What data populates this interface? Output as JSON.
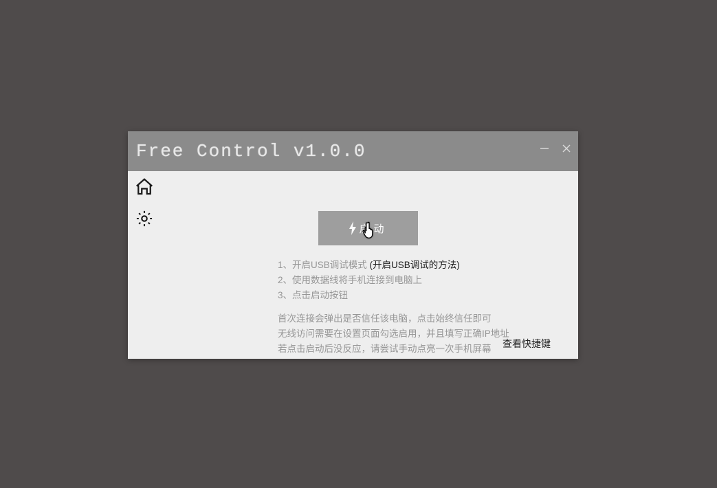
{
  "titlebar": {
    "title": "Free Control v1.0.0"
  },
  "main": {
    "start_label": "启动"
  },
  "instructions": {
    "step1_prefix": "1、开启USB调试模式",
    "step1_link": "(开启USB调试的方法)",
    "step2": "2、使用数据线将手机连接到电脑上",
    "step3": "3、点击启动按钮"
  },
  "notes": {
    "line1": "首次连接会弹出是否信任该电脑，点击始终信任即可",
    "line2": "无线访问需要在设置页面勾选启用，并且填写正确IP地址",
    "line3": "若点击启动后没反应，请尝试手动点亮一次手机屏幕"
  },
  "footer": {
    "shortcuts": "查看快捷键"
  }
}
